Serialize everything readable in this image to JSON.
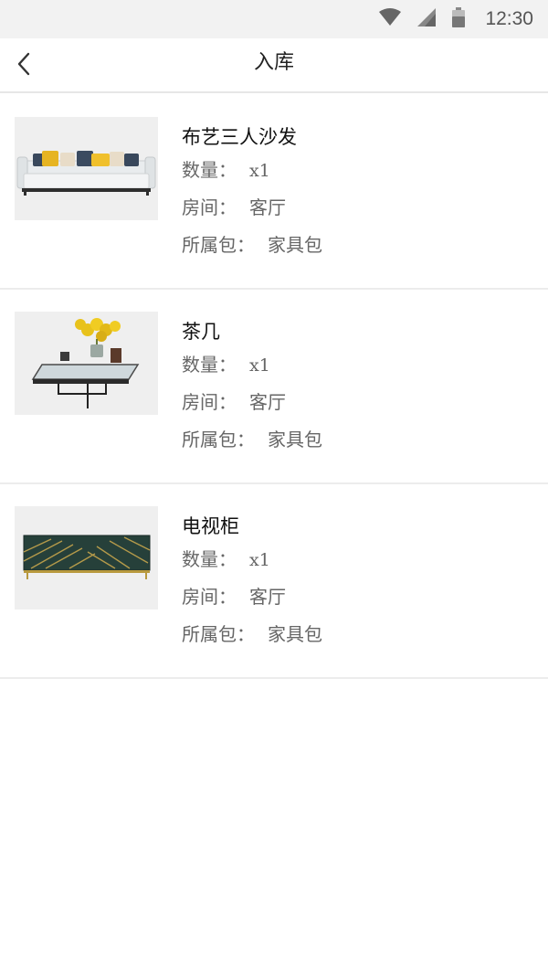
{
  "status_bar": {
    "time": "12:30",
    "icons": [
      "wifi-icon",
      "signal-icon",
      "battery-icon"
    ]
  },
  "nav": {
    "back_icon": "chevron-left-icon",
    "title": "入库"
  },
  "labels": {
    "quantity": "数量：",
    "room": "房间：",
    "package": "所属包："
  },
  "items": [
    {
      "name": "布艺三人沙发",
      "quantity": "x1",
      "room": "客厅",
      "package": "家具包",
      "image": "sofa-image"
    },
    {
      "name": "茶几",
      "quantity": "x1",
      "room": "客厅",
      "package": "家具包",
      "image": "coffee-table-image"
    },
    {
      "name": "电视柜",
      "quantity": "x1",
      "room": "客厅",
      "package": "家具包",
      "image": "tv-cabinet-image"
    }
  ],
  "colors": {
    "status_bar_bg": "#f2f2f2",
    "divider": "#ececec",
    "label_text": "#666666",
    "title_text": "#222222"
  }
}
